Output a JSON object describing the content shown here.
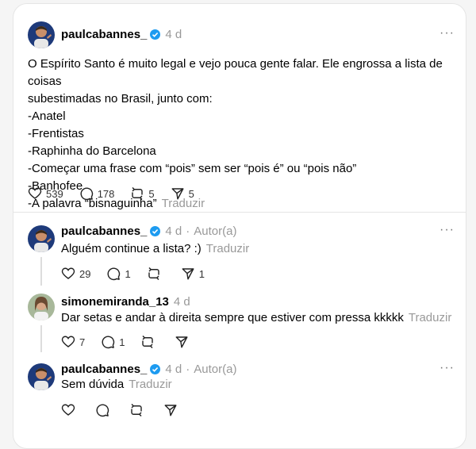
{
  "original": {
    "username": "paulcabannes_",
    "time": "4 d",
    "lines": [
      "O Espírito Santo é muito legal e vejo pouca gente falar. Ele engrossa a lista de coisas",
      "subestimadas no Brasil, junto com:",
      "-Anatel",
      "-Frentistas",
      "-Raphinha do Barcelona",
      "-Começar uma frase com “pois” sem ser “pois é” ou “pois não”",
      "-Banhofee",
      "-A palavra “bisnaguinha”"
    ],
    "translate": "Traduzir",
    "likes": "539",
    "comments": "178",
    "reposts": "5",
    "shares": "5"
  },
  "reply1": {
    "username": "paulcabannes_",
    "time": "4 d",
    "author_tag": "Autor(a)",
    "text": "Alguém continue a lista? :)",
    "translate": "Traduzir",
    "likes": "29",
    "comments": "1",
    "shares": "1"
  },
  "reply2": {
    "username": "simonemiranda_13",
    "time": "4 d",
    "text": "Dar setas e andar à direita sempre que estiver com pressa kkkkk",
    "translate": "Traduzir",
    "likes": "7",
    "comments": "1"
  },
  "reply3": {
    "username": "paulcabannes_",
    "time": "4 d",
    "author_tag": "Autor(a)",
    "text": "Sem dúvida",
    "translate": "Traduzir"
  },
  "more_glyph": "···",
  "colors": {
    "verified": "#1d9bf0",
    "muted": "#999999"
  }
}
